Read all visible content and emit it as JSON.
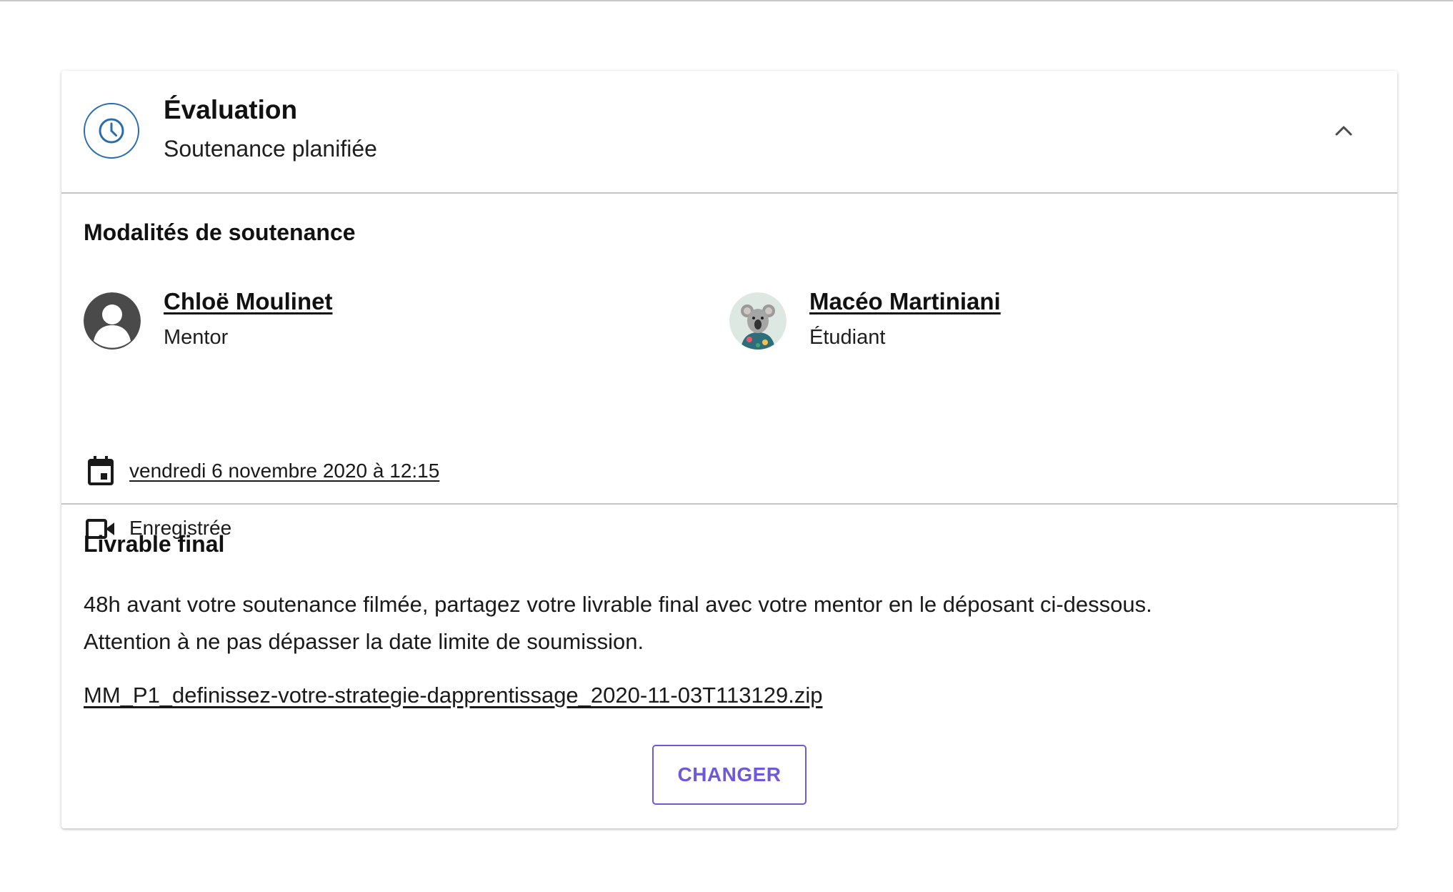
{
  "header": {
    "title": "Évaluation",
    "subtitle": "Soutenance planifiée",
    "status_icon": "clock-icon",
    "collapse_icon": "chevron-up-icon"
  },
  "defense": {
    "section_title": "Modalités de soutenance",
    "mentor": {
      "name": "Chloë Moulinet",
      "role": "Mentor",
      "avatar": "default-user-avatar"
    },
    "student": {
      "name": "Macéo Martiniani",
      "role": "Étudiant",
      "avatar": "koala-avatar"
    },
    "date_icon": "calendar-icon",
    "date_text": "vendredi 6 novembre 2020 à 12:15",
    "recording_icon": "video-camera-icon",
    "recording_text": "Enregistrée"
  },
  "deliverable": {
    "section_title": "Livrable final",
    "line1": "48h avant votre soutenance filmée, partagez votre livrable final avec votre mentor en le déposant ci-dessous.",
    "line2": "Attention à ne pas dépasser la date limite de soumission.",
    "file_name": "MM_P1_definissez-votre-strategie-dapprentissage_2020-11-03T113129.zip",
    "button_label": "CHANGER"
  },
  "colors": {
    "accent": "#6e5ad8",
    "status_blue": "#2b6cb0",
    "divider": "#c4c4c4"
  }
}
